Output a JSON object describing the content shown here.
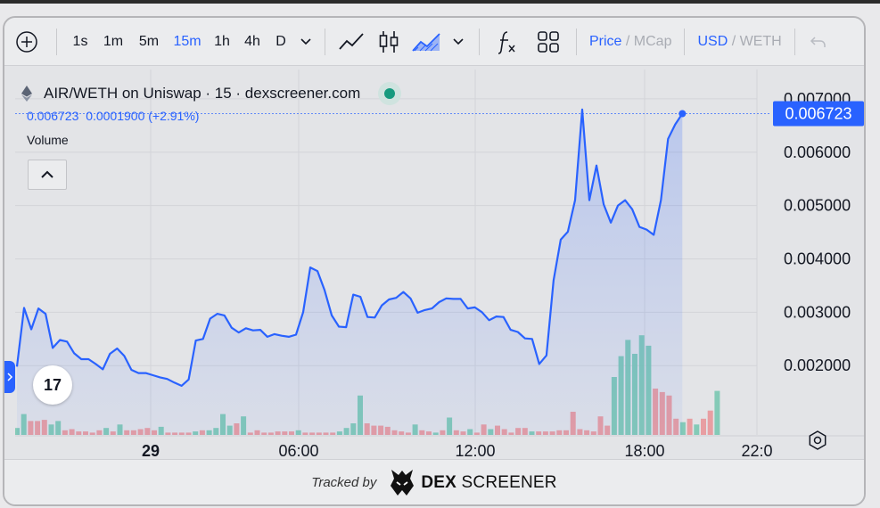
{
  "toolbar": {
    "timeframes": [
      "1s",
      "1m",
      "5m",
      "15m",
      "1h",
      "4h",
      "D"
    ],
    "active_timeframe": "15m",
    "price_label": "Price",
    "mcap_label": "MCap",
    "usd_label": "USD",
    "weth_label": "WETH"
  },
  "legend": {
    "title": "AIR/WETH on Uniswap · 15 · dexscreener.com",
    "last_value": "0.006723",
    "change": "0.0001900 (+2.91%)",
    "volume_label": "Volume"
  },
  "footer": {
    "tracked_by": "Tracked by",
    "brand_bold": "DEX",
    "brand_rest": "SCREENER"
  },
  "tv_logo": "17",
  "colors": {
    "line": "#2962ff",
    "volume_up": "#7ec8b4",
    "volume_down": "#e89a9e",
    "accent": "#2962ff"
  },
  "chart_data": {
    "type": "area",
    "title": "AIR/WETH on Uniswap · 15 · dexscreener.com",
    "x_ticks": [
      "29",
      "06:00",
      "12:00",
      "18:00",
      "22:0"
    ],
    "y_ticks": [
      "0.002000",
      "0.003000",
      "0.004000",
      "0.005000",
      "0.006000",
      "0.007000"
    ],
    "ylim": [
      0.0007,
      0.00755
    ],
    "last_price_label": "0.006723",
    "price": [
      0.00198,
      0.00308,
      0.00268,
      0.00307,
      0.00297,
      0.00233,
      0.00248,
      0.00245,
      0.00223,
      0.00212,
      0.00212,
      0.00203,
      0.00193,
      0.00222,
      0.00232,
      0.00218,
      0.00192,
      0.00186,
      0.00186,
      0.00182,
      0.00178,
      0.00175,
      0.00168,
      0.00162,
      0.00174,
      0.00247,
      0.0025,
      0.00288,
      0.00297,
      0.00294,
      0.00271,
      0.00262,
      0.0027,
      0.00266,
      0.00267,
      0.00254,
      0.00259,
      0.00256,
      0.00254,
      0.00258,
      0.003,
      0.00384,
      0.00377,
      0.00341,
      0.00294,
      0.00273,
      0.00272,
      0.00333,
      0.00329,
      0.00291,
      0.0029,
      0.00313,
      0.00324,
      0.00327,
      0.00338,
      0.00326,
      0.00299,
      0.00304,
      0.00307,
      0.00319,
      0.00326,
      0.00325,
      0.00325,
      0.00307,
      0.00309,
      0.003,
      0.00285,
      0.00292,
      0.00291,
      0.00267,
      0.00263,
      0.00251,
      0.0025,
      0.00203,
      0.00219,
      0.0036,
      0.00436,
      0.00451,
      0.0051,
      0.0068,
      0.0051,
      0.00575,
      0.00502,
      0.00468,
      0.005,
      0.0051,
      0.00493,
      0.0046,
      0.00455,
      0.00445,
      0.0051,
      0.00625,
      0.00652,
      0.006723
    ],
    "volume": [
      6,
      18,
      12,
      12,
      13,
      9,
      12,
      4,
      5,
      3,
      3,
      2,
      4,
      6,
      3,
      9,
      4,
      4,
      5,
      6,
      4,
      7,
      2,
      2,
      2,
      2,
      3,
      4,
      4,
      6,
      18,
      8,
      10,
      16,
      2,
      4,
      2,
      2,
      3,
      3,
      3,
      4,
      2,
      2,
      2,
      2,
      2,
      3,
      6,
      10,
      34,
      10,
      8,
      8,
      7,
      4,
      3,
      2,
      9,
      4,
      3,
      2,
      4,
      15,
      4,
      3,
      5,
      2,
      9,
      5,
      8,
      5,
      2,
      6,
      6,
      3,
      3,
      3,
      3,
      4,
      4,
      20,
      5,
      4,
      3,
      16,
      8,
      50,
      68,
      82,
      70,
      86,
      77,
      40,
      37,
      34,
      14,
      11,
      14,
      9,
      14,
      21,
      38,
      13,
      7
    ],
    "volume_up": [
      true,
      true,
      false,
      false,
      false,
      true,
      true,
      false,
      false,
      false,
      false,
      false,
      false,
      true,
      false,
      true,
      false,
      false,
      false,
      false,
      false,
      true,
      false,
      false,
      false,
      false,
      true,
      false,
      true,
      true,
      true,
      true,
      false,
      true,
      false,
      false,
      false,
      false,
      false,
      false,
      false,
      true,
      false,
      false,
      false,
      false,
      false,
      true,
      true,
      true,
      true,
      false,
      false,
      false,
      false,
      false,
      false,
      false,
      true,
      false,
      false,
      true,
      false,
      true,
      false,
      false,
      true,
      false,
      false,
      true,
      false,
      false,
      false,
      false,
      false,
      true,
      false,
      false,
      false,
      false,
      false,
      false,
      false,
      false,
      false,
      false,
      false,
      true,
      true,
      true,
      true,
      true,
      true,
      false,
      false,
      false,
      false,
      true,
      false,
      true,
      false,
      false,
      true,
      true,
      true
    ]
  }
}
